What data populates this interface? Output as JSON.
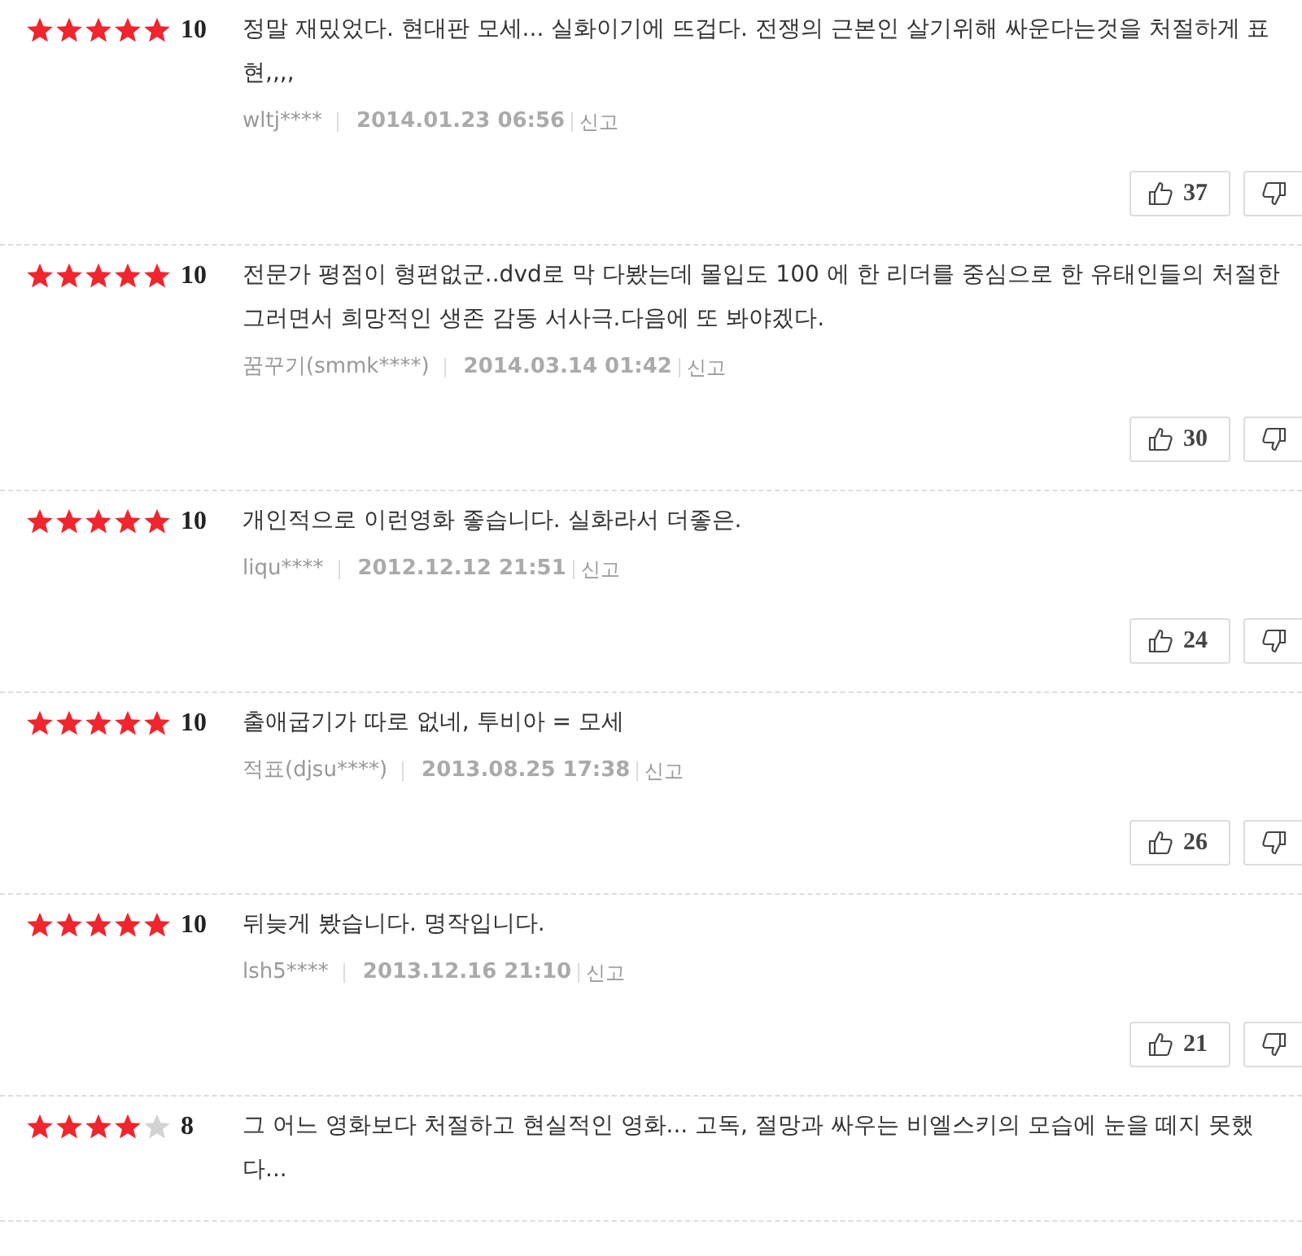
{
  "reviews": [
    {
      "stars": 5,
      "score": "10",
      "comment": "정말 재밌었다. 현대판 모세... 실화이기에 뜨겁다. 전쟁의 근본인 살기위해 싸운다는것을 처절하게 표현,,,,",
      "author": "wltj****",
      "date": "2014.01.23 06:56",
      "report": "신고",
      "likes": "37"
    },
    {
      "stars": 5,
      "score": "10",
      "comment": "전문가 평점이 형편없군..dvd로 막 다봤는데 몰입도 100 에 한 리더를 중심으로 한 유태인들의 처절한 그러면서 희망적인 생존 감동 서사극.다음에 또 봐야겠다.",
      "author": "꿈꾸기(smmk****)",
      "date": "2014.03.14 01:42",
      "report": "신고",
      "likes": "30"
    },
    {
      "stars": 5,
      "score": "10",
      "comment": "개인적으로 이런영화 좋습니다. 실화라서 더좋은.",
      "author": "liqu****",
      "date": "2012.12.12 21:51",
      "report": "신고",
      "likes": "24"
    },
    {
      "stars": 5,
      "score": "10",
      "comment": "출애굽기가 따로 없네, 투비아 = 모세",
      "author": "적표(djsu****)",
      "date": "2013.08.25 17:38",
      "report": "신고",
      "likes": "26"
    },
    {
      "stars": 5,
      "score": "10",
      "comment": "뒤늦게 봤습니다. 명작입니다.",
      "author": "lsh5****",
      "date": "2013.12.16 21:10",
      "report": "신고",
      "likes": "21"
    },
    {
      "stars": 4,
      "score": "8",
      "comment": "그 어느 영화보다 처절하고 현실적인 영화... 고독, 절망과 싸우는 비엘스키의 모습에 눈을 떼지 못했다..."
    }
  ]
}
